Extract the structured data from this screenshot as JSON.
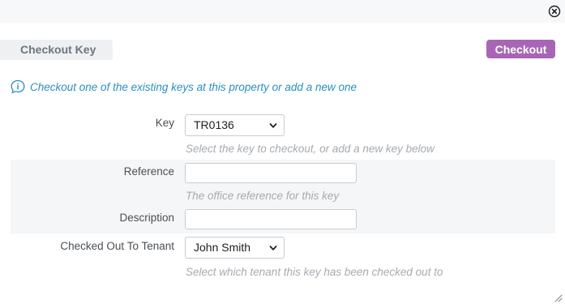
{
  "header": {
    "close_icon": "close-circle-icon"
  },
  "tab": {
    "label": "Checkout Key"
  },
  "actions": {
    "checkout_label": "Checkout"
  },
  "info": {
    "icon": "speech-info-icon",
    "text": "Checkout one of the existing keys at this property or add a new one"
  },
  "form": {
    "key": {
      "label": "Key",
      "selected": "TR0136",
      "help": "Select the key to checkout, or add a new key below"
    },
    "reference": {
      "label": "Reference",
      "value": "",
      "help": "The office reference for this key"
    },
    "description": {
      "label": "Description",
      "value": ""
    },
    "tenant": {
      "label": "Checked Out To Tenant",
      "selected": "John Smith",
      "help": "Select which tenant this key has been checked out to"
    }
  },
  "colors": {
    "accent": "#a865b5",
    "info_text": "#2a8fc0",
    "help_text": "#a5abb1",
    "band": "#f5f6f7"
  }
}
